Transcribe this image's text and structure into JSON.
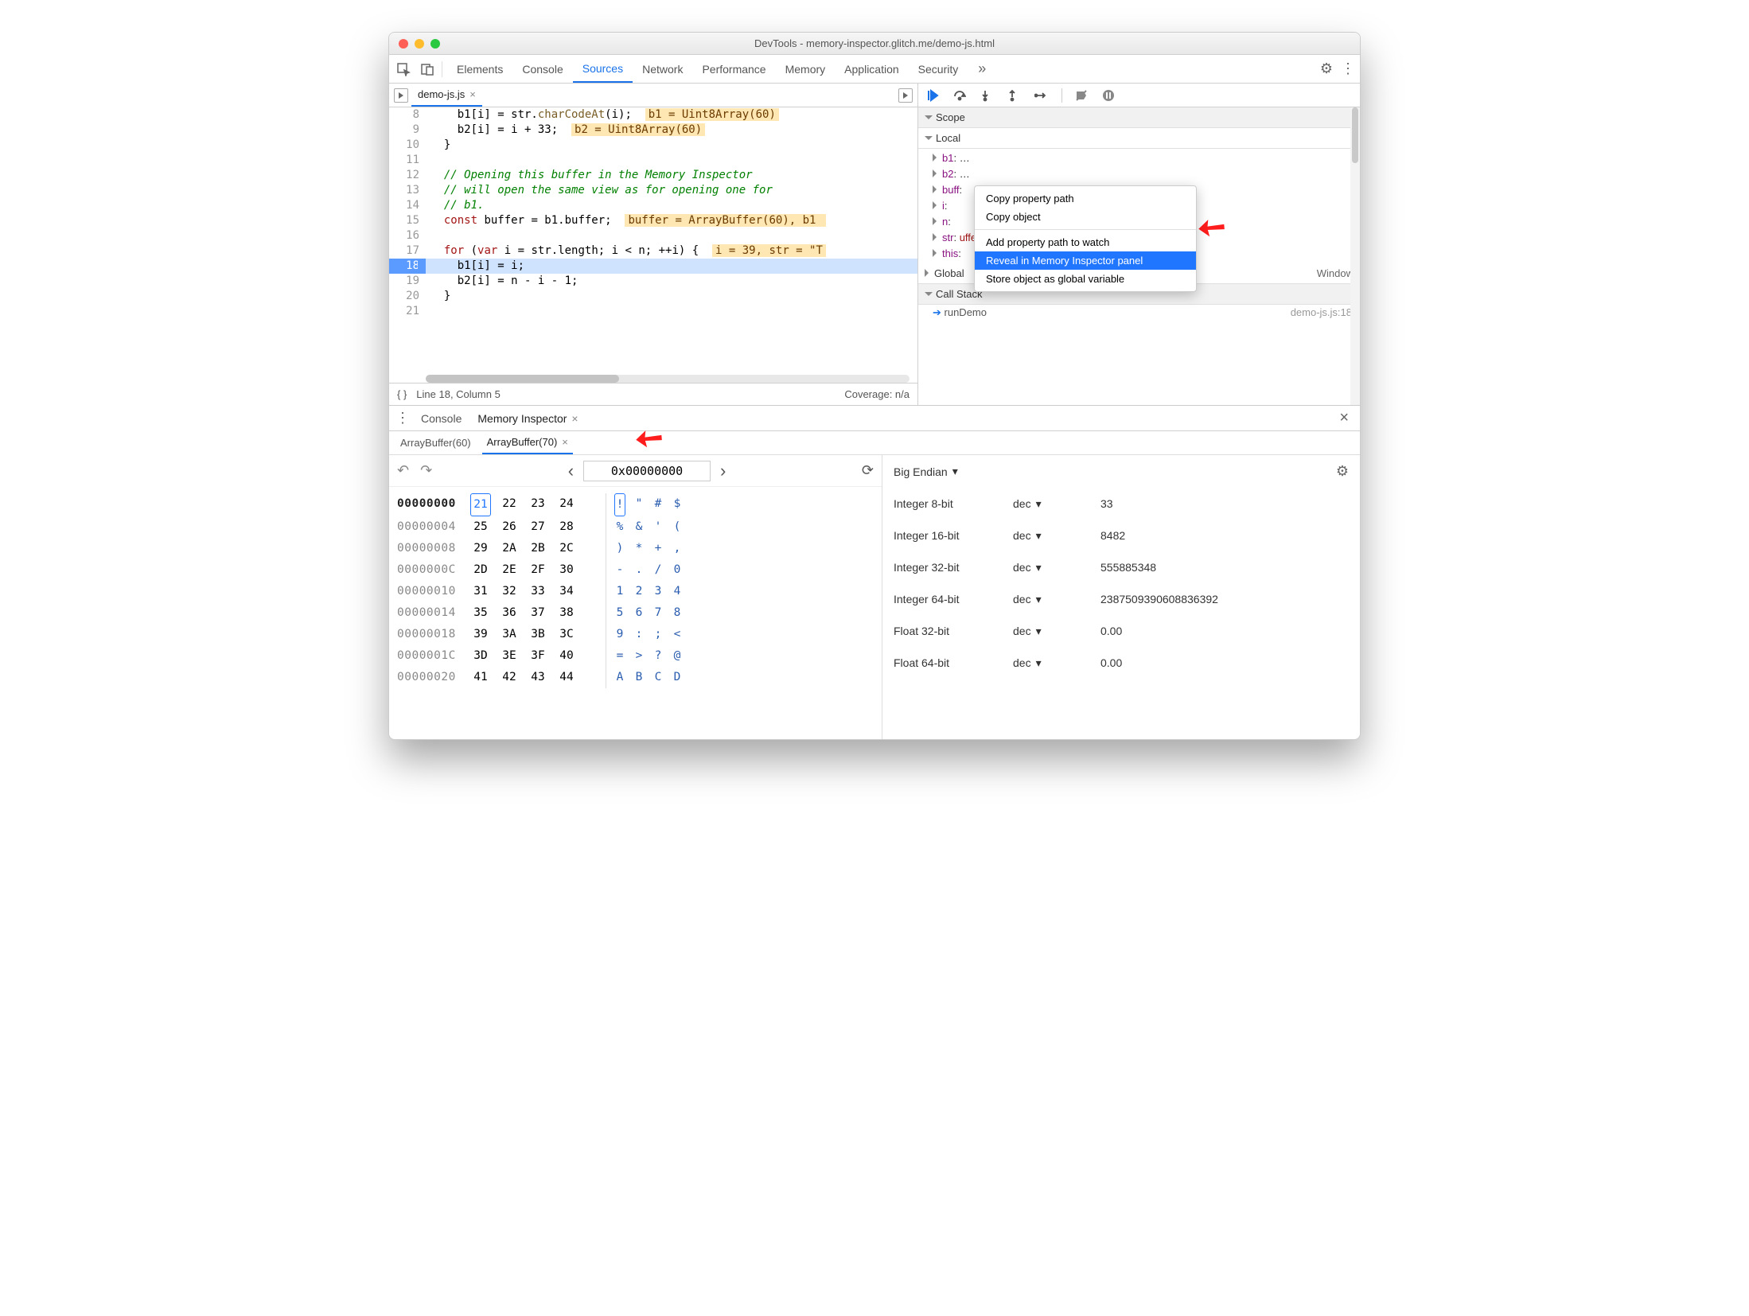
{
  "title": "DevTools - memory-inspector.glitch.me/demo-js.html",
  "mainTabs": [
    "Elements",
    "Console",
    "Sources",
    "Network",
    "Performance",
    "Memory",
    "Application",
    "Security"
  ],
  "mainTabActive": "Sources",
  "fileTab": "demo-js.js",
  "code": {
    "lines": [
      {
        "n": 8,
        "html": "    b1[i] = str.<span class='prop'>charCodeAt</span>(i);  <span class='inline-val'>b1 = Uint8Array(60)</span>"
      },
      {
        "n": 9,
        "html": "    b2[i] = i + 33;  <span class='inline-val'>b2 = Uint8Array(60)</span>"
      },
      {
        "n": 10,
        "html": "  }"
      },
      {
        "n": 11,
        "html": ""
      },
      {
        "n": 12,
        "html": "  <span class='cm'>// Opening this buffer in the Memory Inspector</span>"
      },
      {
        "n": 13,
        "html": "  <span class='cm'>// will open the same view as for opening one for</span>"
      },
      {
        "n": 14,
        "html": "  <span class='cm'>// b1.</span>"
      },
      {
        "n": 15,
        "html": "  <span class='kw'>const</span> buffer = b1.buffer;  <span class='inline-val'>buffer = ArrayBuffer(60), b1 </span>"
      },
      {
        "n": 16,
        "html": ""
      },
      {
        "n": 17,
        "html": "  <span class='kw'>for</span> (<span class='kw'>var</span> i = str.length; i &lt; n; ++i) {  <span class='inline-val'>i = 39, str = &quot;T</span>"
      },
      {
        "n": 18,
        "html": "    b1[i] = i;",
        "hl": true
      },
      {
        "n": 19,
        "html": "    b2[i] = n - i - 1;"
      },
      {
        "n": 20,
        "html": "  }"
      },
      {
        "n": 21,
        "html": ""
      }
    ]
  },
  "statusLeft": "Line 18, Column 5",
  "statusRight": "Coverage: n/a",
  "statusPretty": "{ }",
  "scope": {
    "header": "Scope",
    "local": "Local",
    "items": [
      {
        "k": "b1",
        "v": "…"
      },
      {
        "k": "b2",
        "v": "…"
      },
      {
        "k": "buff",
        "v": ""
      },
      {
        "k": "i",
        "v": ""
      },
      {
        "k": "n",
        "v": ""
      },
      {
        "k": "str",
        "v": "",
        "after": "uffer :)!\""
      },
      {
        "k": "this",
        "v": ""
      }
    ],
    "global": "Global",
    "globalVal": "Window",
    "callstack": "Call Stack",
    "csItem": "runDemo",
    "csLoc": "demo-js.js:18"
  },
  "ctx": {
    "items": [
      "Copy property path",
      "Copy object",
      "-",
      "Add property path to watch",
      "Reveal in Memory Inspector panel",
      "Store object as global variable"
    ],
    "sel": "Reveal in Memory Inspector panel"
  },
  "drawer": {
    "tabs": [
      "Console",
      "Memory Inspector"
    ],
    "active": "Memory Inspector",
    "buffers": [
      "ArrayBuffer(60)",
      "ArrayBuffer(70)"
    ],
    "bufActive": "ArrayBuffer(70)",
    "addr": "0x00000000",
    "endian": "Big Endian",
    "hex": [
      {
        "addr": "00000000",
        "first": true,
        "b": [
          "21",
          "22",
          "23",
          "24"
        ],
        "a": [
          "!",
          "\"",
          "#",
          "$"
        ],
        "sel": 0
      },
      {
        "addr": "00000004",
        "b": [
          "25",
          "26",
          "27",
          "28"
        ],
        "a": [
          "%",
          "&",
          "'",
          "("
        ]
      },
      {
        "addr": "00000008",
        "b": [
          "29",
          "2A",
          "2B",
          "2C"
        ],
        "a": [
          ")",
          "*",
          "+",
          ","
        ]
      },
      {
        "addr": "0000000C",
        "b": [
          "2D",
          "2E",
          "2F",
          "30"
        ],
        "a": [
          "-",
          ".",
          "/",
          "0"
        ]
      },
      {
        "addr": "00000010",
        "b": [
          "31",
          "32",
          "33",
          "34"
        ],
        "a": [
          "1",
          "2",
          "3",
          "4"
        ]
      },
      {
        "addr": "00000014",
        "b": [
          "35",
          "36",
          "37",
          "38"
        ],
        "a": [
          "5",
          "6",
          "7",
          "8"
        ]
      },
      {
        "addr": "00000018",
        "b": [
          "39",
          "3A",
          "3B",
          "3C"
        ],
        "a": [
          "9",
          ":",
          ";",
          "<"
        ]
      },
      {
        "addr": "0000001C",
        "b": [
          "3D",
          "3E",
          "3F",
          "40"
        ],
        "a": [
          "=",
          ">",
          "?",
          "@"
        ]
      },
      {
        "addr": "00000020",
        "b": [
          "41",
          "42",
          "43",
          "44"
        ],
        "a": [
          "A",
          "B",
          "C",
          "D"
        ]
      }
    ],
    "values": [
      {
        "name": "Integer 8-bit",
        "enc": "dec",
        "val": "33"
      },
      {
        "name": "Integer 16-bit",
        "enc": "dec",
        "val": "8482"
      },
      {
        "name": "Integer 32-bit",
        "enc": "dec",
        "val": "555885348"
      },
      {
        "name": "Integer 64-bit",
        "enc": "dec",
        "val": "2387509390608836392"
      },
      {
        "name": "Float 32-bit",
        "enc": "dec",
        "val": "0.00"
      },
      {
        "name": "Float 64-bit",
        "enc": "dec",
        "val": "0.00"
      }
    ]
  },
  "icons": {
    "more": "»",
    "gear": "⚙",
    "kebab": "⋮",
    "undo": "↶",
    "redo": "↷",
    "prev": "‹",
    "next": "›",
    "refresh": "⟳",
    "caret": "▾"
  }
}
